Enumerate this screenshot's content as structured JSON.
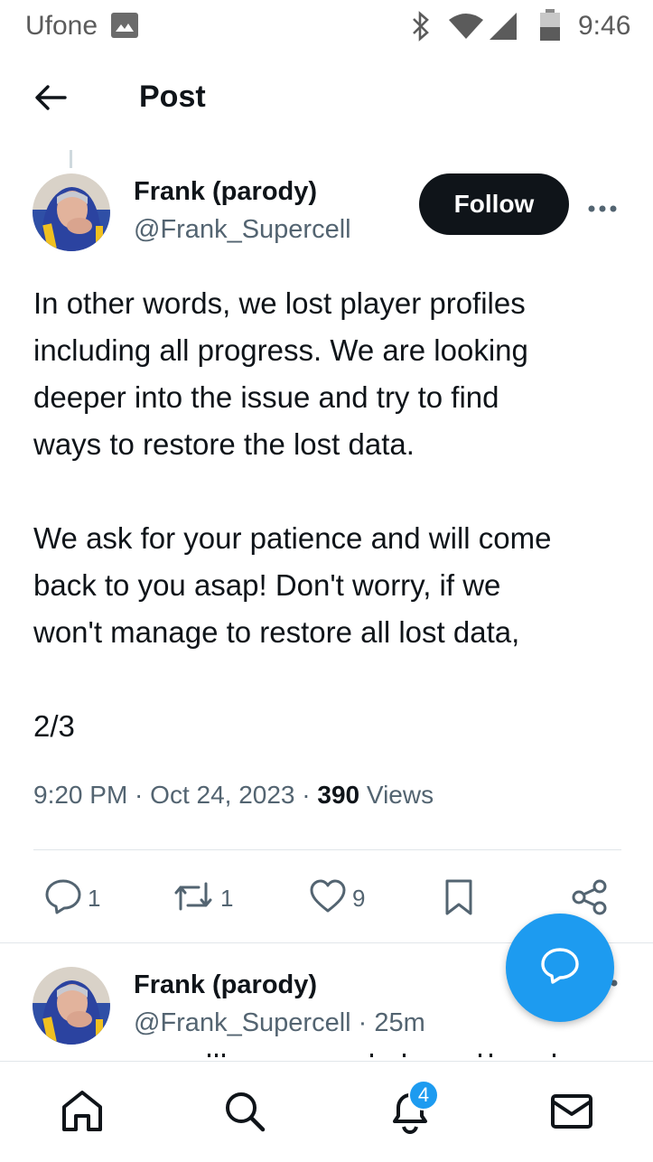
{
  "status_bar": {
    "carrier": "Ufone",
    "time": "9:46"
  },
  "header": {
    "title": "Post"
  },
  "post": {
    "author_name": "Frank (parody)",
    "author_handle": "@Frank_Supercell",
    "follow_label": "Follow",
    "text": "In other words, we lost player profiles\nincluding all progress. We are looking\ndeeper into the issue and try to find\nways to restore the lost data.\n\nWe ask for your patience and will come\nback to you asap! Don't worry, if we\nwon't manage to restore all lost data,\n\n2/3",
    "time": "9:20 PM",
    "sep1": " · ",
    "date": "Oct 24, 2023",
    "sep2": " · ",
    "views_count": "390",
    "views_label": " Views",
    "actions": {
      "replies": "1",
      "reposts": "1",
      "likes": "9"
    }
  },
  "reply": {
    "author_name": "Frank (parody)",
    "author_handle": "@Frank_Supercell",
    "separator": " · ",
    "time": "25m"
  },
  "bottom_nav": {
    "notifications_badge": "4"
  },
  "icons": [
    "back-arrow-icon",
    "more-icon",
    "reply-icon",
    "repost-icon",
    "like-icon",
    "bookmark-icon",
    "share-icon",
    "compose-reply-icon",
    "home-icon",
    "search-icon",
    "bell-icon",
    "mail-icon"
  ],
  "colors": {
    "accent": "#1d9bf0",
    "follow_bg": "#0f1419",
    "secondary_text": "#536471"
  }
}
